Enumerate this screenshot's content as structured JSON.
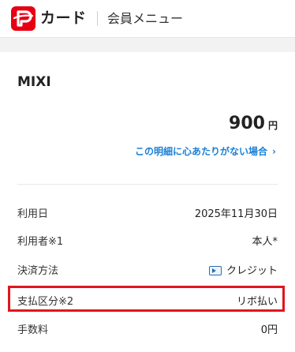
{
  "header": {
    "brand": "カード",
    "menu_label": "会員メニュー",
    "logo_icon": "paypay-logo-icon",
    "brand_color": "#e60012"
  },
  "transaction": {
    "merchant": "MIXI",
    "amount": "900",
    "currency": "円",
    "help_link": "この明細に心あたりがない場合",
    "link_color": "#1a7fd6"
  },
  "details": [
    {
      "label": "利用日",
      "value": "2025年11月30日"
    },
    {
      "label": "利用者※1",
      "value": "本人*"
    },
    {
      "label": "決済方法",
      "value": "クレジット",
      "icon": "credit-card-icon"
    },
    {
      "label": "支払区分※2",
      "value": "リボ払い",
      "highlighted": true
    },
    {
      "label": "手数料",
      "value": "0円"
    }
  ],
  "highlight_color": "#e0161d"
}
